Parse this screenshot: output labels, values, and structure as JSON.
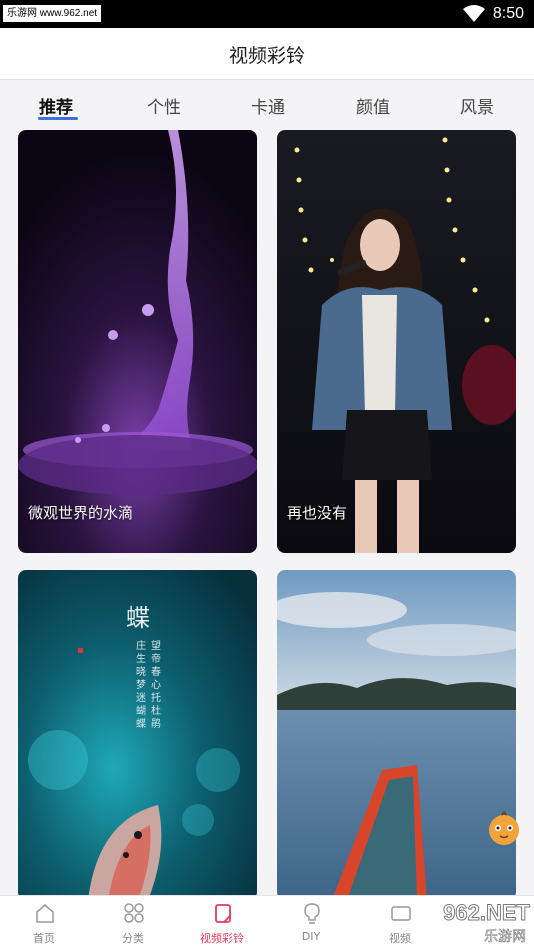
{
  "status_bar": {
    "watermark_text": "乐游网 www.962.net",
    "time": "8:50",
    "wifi_icon": "wifi-icon"
  },
  "header": {
    "title": "视频彩铃"
  },
  "tabs": [
    {
      "label": "推荐",
      "active": true
    },
    {
      "label": "个性",
      "active": false
    },
    {
      "label": "卡通",
      "active": false
    },
    {
      "label": "颜值",
      "active": false
    },
    {
      "label": "风景",
      "active": false
    }
  ],
  "videos": [
    {
      "caption": "微观世界的水滴"
    },
    {
      "caption": "再也没有"
    },
    {
      "caption": "",
      "poster_title": "蝶",
      "poster_lines": [
        "庄生晓梦迷蝴蝶",
        "望帝春心托杜鹃"
      ]
    },
    {
      "caption": ""
    }
  ],
  "bottom_nav": [
    {
      "label": "首页",
      "icon": "home-icon",
      "active": false
    },
    {
      "label": "分类",
      "icon": "category-icon",
      "active": false
    },
    {
      "label": "视频彩铃",
      "icon": "video-ringtone-icon",
      "active": true
    },
    {
      "label": "DIY",
      "icon": "lightbulb-icon",
      "active": false
    },
    {
      "label": "视频",
      "icon": "video-icon",
      "active": false
    }
  ],
  "site_watermark": {
    "line1": "962.NET",
    "line2": "乐游网"
  },
  "colors": {
    "accent_blue": "#3f6fe0",
    "active_red": "#e53b5a"
  }
}
